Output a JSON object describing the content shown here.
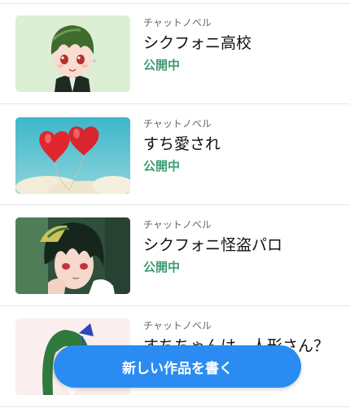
{
  "works": [
    {
      "category": "チャットノベル",
      "title": "シクフォニ高校",
      "status": "公開中",
      "thumbnail": "green-haired-chibi-boy"
    },
    {
      "category": "チャットノベル",
      "title": "すち愛され",
      "status": "公開中",
      "thumbnail": "red-heart-balloons-sky"
    },
    {
      "category": "チャットノベル",
      "title": "シクフォニ怪盗パロ",
      "status": "公開中",
      "thumbnail": "dark-green-haired-boy"
    },
    {
      "category": "チャットノベル",
      "title": "すちちゃんは、人形さん？",
      "status": "",
      "thumbnail": "green-haired-girl-ribbon"
    }
  ],
  "actions": {
    "write_new_label": "新しい作品を書く"
  },
  "colors": {
    "status": "#3e9b73",
    "primary_button": "#2a8cf2",
    "divider": "#e6e6e6"
  }
}
